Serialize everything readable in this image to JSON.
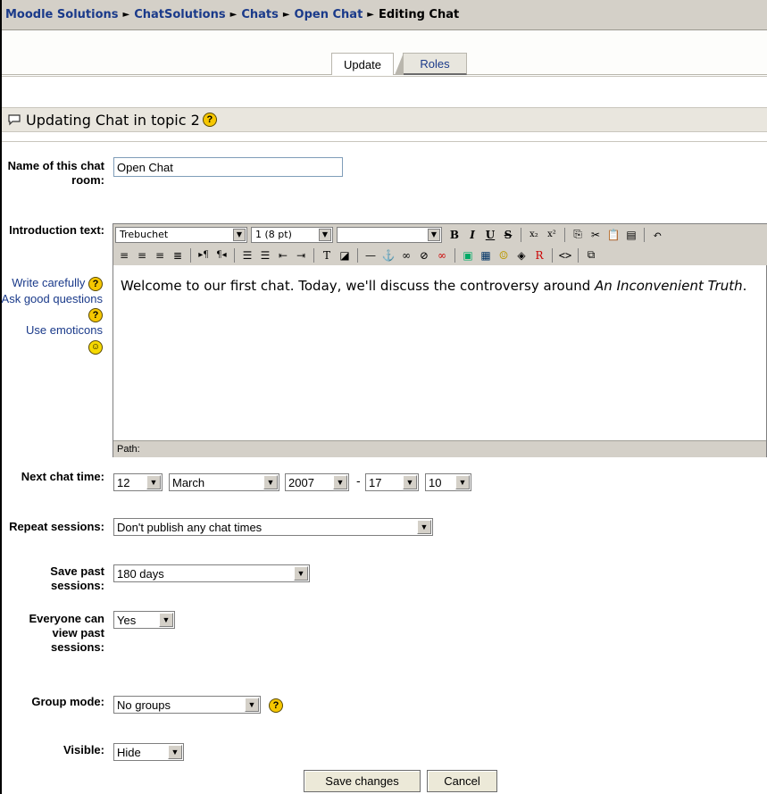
{
  "breadcrumb": {
    "items": [
      "Moodle Solutions",
      "ChatSolutions",
      "Chats",
      "Open Chat"
    ],
    "current": "Editing Chat",
    "separator": "►"
  },
  "tabs": {
    "update": "Update",
    "roles": "Roles"
  },
  "heading": {
    "title": "Updating Chat in topic 2"
  },
  "form": {
    "name_label": "Name of this chat room:",
    "name_value": "Open Chat",
    "intro_label": "Introduction text:",
    "toolbar": {
      "font": "Trebuchet",
      "size": "1 (8 pt)",
      "style": ""
    },
    "intro_text_plain": "Welcome to our first chat. Today, we'll discuss the controversy around ",
    "intro_text_italic": "An Inconvenient Truth",
    "intro_text_end": ".",
    "path_label": "Path:",
    "side_links": {
      "write": "Write carefully",
      "ask": "Ask good questions",
      "emoticons": "Use emoticons"
    },
    "next_chat_label": "Next chat time:",
    "next_day": "12",
    "next_month": "March",
    "next_year": "2007",
    "next_dash": "-",
    "next_hour": "17",
    "next_minute": "10",
    "repeat_label": "Repeat sessions:",
    "repeat_value": "Don't publish any chat times",
    "save_label": "Save past sessions:",
    "save_value": "180 days",
    "everyone_label": "Everyone can view past sessions:",
    "everyone_value": "Yes",
    "group_label": "Group mode:",
    "group_value": "No groups",
    "visible_label": "Visible:",
    "visible_value": "Hide",
    "help_glyph": "?"
  },
  "buttons": {
    "save": "Save changes",
    "cancel": "Cancel"
  },
  "colors": {
    "link": "#1a3a8a",
    "header_bg": "#d4d0c8",
    "help": "#f6c700"
  }
}
